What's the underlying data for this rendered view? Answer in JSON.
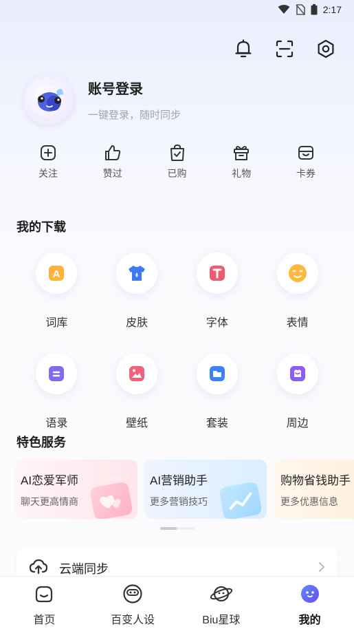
{
  "status_bar": {
    "time": "2:17"
  },
  "top_actions": [
    "bell-icon",
    "scan-icon",
    "settings-icon"
  ],
  "profile": {
    "title": "账号登录",
    "subtitle": "一键登录，随时同步"
  },
  "quick_links": [
    {
      "label": "关注",
      "icon": "follow-plus-icon"
    },
    {
      "label": "赞过",
      "icon": "thumbs-up-icon"
    },
    {
      "label": "已购",
      "icon": "purchased-bag-icon"
    },
    {
      "label": "礼物",
      "icon": "gift-icon"
    },
    {
      "label": "卡券",
      "icon": "coupon-icon"
    }
  ],
  "downloads": {
    "title": "我的下载",
    "items": [
      {
        "label": "词库",
        "icon": "dictionary-icon",
        "color": "#ffb33a"
      },
      {
        "label": "皮肤",
        "icon": "skin-icon",
        "color": "#3c7bf5"
      },
      {
        "label": "字体",
        "icon": "font-icon",
        "color": "#ef5a6e"
      },
      {
        "label": "表情",
        "icon": "emoji-icon",
        "color": "#ffb73d"
      },
      {
        "label": "语录",
        "icon": "quotes-icon",
        "color": "#7d6cf2"
      },
      {
        "label": "壁纸",
        "icon": "wallpaper-icon",
        "color": "#f1617c"
      },
      {
        "label": "套装",
        "icon": "bundle-icon",
        "color": "#3b82f6"
      },
      {
        "label": "周边",
        "icon": "merch-icon",
        "color": "#8b5cf6"
      }
    ]
  },
  "services": {
    "title": "特色服务",
    "cards": [
      {
        "title": "AI恋爱军师",
        "subtitle": "聊天更高情商"
      },
      {
        "title": "AI营销助手",
        "subtitle": "更多营销技巧"
      },
      {
        "title": "购物省钱助手",
        "subtitle": "更多优惠信息"
      }
    ]
  },
  "cloud_sync": {
    "label": "云端同步"
  },
  "tab_bar": [
    {
      "label": "首页",
      "icon": "home-icon",
      "active": false
    },
    {
      "label": "百变人设",
      "icon": "persona-icon",
      "active": false
    },
    {
      "label": "Biu星球",
      "icon": "planet-icon",
      "active": false
    },
    {
      "label": "我的",
      "icon": "mine-icon",
      "active": true
    }
  ],
  "colors": {
    "accent": "#4b6bf5",
    "text": "#222222",
    "muted": "#a2a5ad"
  }
}
